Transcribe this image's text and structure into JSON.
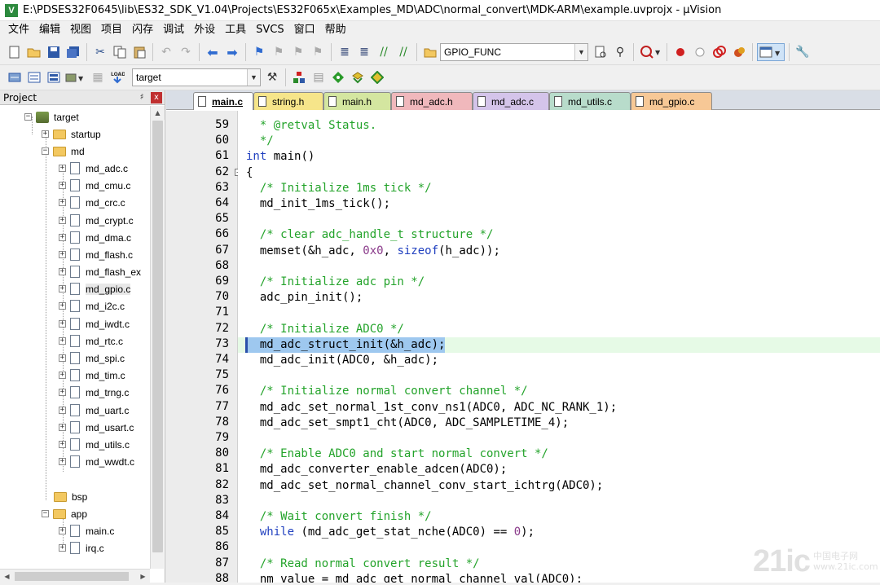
{
  "window": {
    "title": "E:\\PDSES32F0645\\lib\\ES32_SDK_V1.04\\Projects\\ES32F065x\\Examples_MD\\ADC\\normal_convert\\MDK-ARM\\example.uvprojx - µVision",
    "app_icon_letter": "V"
  },
  "menu": [
    "文件",
    "编辑",
    "视图",
    "项目",
    "闪存",
    "调试",
    "外设",
    "工具",
    "SVCS",
    "窗口",
    "帮助"
  ],
  "toolbar1": {
    "find_combo_value": "GPIO_FUNC"
  },
  "toolbar2": {
    "target_combo_value": "target"
  },
  "project_panel": {
    "title": "Project",
    "pin": "♯",
    "close": "x",
    "tree": {
      "target": "target",
      "startup": "startup",
      "md": "md",
      "md_files": [
        "md_adc.c",
        "md_cmu.c",
        "md_crc.c",
        "md_crypt.c",
        "md_dma.c",
        "md_flash.c",
        "md_flash_ex",
        "md_gpio.c",
        "md_i2c.c",
        "md_iwdt.c",
        "md_rtc.c",
        "md_spi.c",
        "md_tim.c",
        "md_trng.c",
        "md_uart.c",
        "md_usart.c",
        "md_utils.c",
        "md_wwdt.c"
      ],
      "bsp": "bsp",
      "app": "app",
      "app_files": [
        "main.c",
        "irq.c"
      ]
    }
  },
  "tabs": [
    {
      "label": "main.c",
      "color": "#ffffff",
      "active": true
    },
    {
      "label": "string.h",
      "color": "#f6e58a",
      "active": false
    },
    {
      "label": "main.h",
      "color": "#d4e6a0",
      "active": false
    },
    {
      "label": "md_adc.h",
      "color": "#f0b8bc",
      "active": false
    },
    {
      "label": "md_adc.c",
      "color": "#d4c4ea",
      "active": false
    },
    {
      "label": "md_utils.c",
      "color": "#b8dccb",
      "active": false
    },
    {
      "label": "md_gpio.c",
      "color": "#f7c896",
      "active": false
    }
  ],
  "editor": {
    "current_line": 73,
    "lines": [
      {
        "no": "59",
        "text": "  * @retval Status.",
        "kind": "comment"
      },
      {
        "no": "60",
        "text": "  */",
        "kind": "comment"
      },
      {
        "no": "61",
        "text": "int main()",
        "kind": "code"
      },
      {
        "no": "62",
        "text": "{",
        "kind": "code"
      },
      {
        "no": "63",
        "text": "  /* Initialize 1ms tick */",
        "kind": "comment"
      },
      {
        "no": "64",
        "text": "  md_init_1ms_tick();",
        "kind": "code"
      },
      {
        "no": "65",
        "text": "",
        "kind": "code"
      },
      {
        "no": "66",
        "text": "  /* clear adc_handle_t structure */",
        "kind": "comment"
      },
      {
        "no": "67",
        "text": "  memset(&h_adc, 0x0, sizeof(h_adc));",
        "kind": "code"
      },
      {
        "no": "68",
        "text": "",
        "kind": "code"
      },
      {
        "no": "69",
        "text": "  /* Initialize adc pin */",
        "kind": "comment"
      },
      {
        "no": "70",
        "text": "  adc_pin_init();",
        "kind": "code"
      },
      {
        "no": "71",
        "text": "",
        "kind": "code"
      },
      {
        "no": "72",
        "text": "  /* Initialize ADC0 */",
        "kind": "comment"
      },
      {
        "no": "73",
        "text": "  md_adc_struct_init(&h_adc);",
        "kind": "code"
      },
      {
        "no": "74",
        "text": "  md_adc_init(ADC0, &h_adc);",
        "kind": "code"
      },
      {
        "no": "75",
        "text": "",
        "kind": "code"
      },
      {
        "no": "76",
        "text": "  /* Initialize normal convert channel */",
        "kind": "comment"
      },
      {
        "no": "77",
        "text": "  md_adc_set_normal_1st_conv_ns1(ADC0, ADC_NC_RANK_1);",
        "kind": "code"
      },
      {
        "no": "78",
        "text": "  md_adc_set_smpt1_cht(ADC0, ADC_SAMPLETIME_4);",
        "kind": "code"
      },
      {
        "no": "79",
        "text": "",
        "kind": "code"
      },
      {
        "no": "80",
        "text": "  /* Enable ADC0 and start normal convert */",
        "kind": "comment"
      },
      {
        "no": "81",
        "text": "  md_adc_converter_enable_adcen(ADC0);",
        "kind": "code"
      },
      {
        "no": "82",
        "text": "  md_adc_set_normal_channel_conv_start_ichtrg(ADC0);",
        "kind": "code"
      },
      {
        "no": "83",
        "text": "",
        "kind": "code"
      },
      {
        "no": "84",
        "text": "  /* Wait convert finish */",
        "kind": "comment"
      },
      {
        "no": "85",
        "text": "  while (md_adc_get_stat_nche(ADC0) == 0);",
        "kind": "code"
      },
      {
        "no": "86",
        "text": "",
        "kind": "code"
      },
      {
        "no": "87",
        "text": "  /* Read normal convert result */",
        "kind": "comment"
      },
      {
        "no": "88",
        "text": "  nm_value = md_adc_get_normal_channel_val(ADC0);",
        "kind": "code"
      }
    ]
  },
  "watermark": {
    "big": "21ic",
    "small_line1": "中国电子网",
    "small_line2": "www.21ic.com"
  },
  "colors": {
    "comment": "#23a32a",
    "keyword": "#1f3fbf",
    "number": "#8a3a8a",
    "selection": "#9ec8ef",
    "current_line": "#e6fae6"
  }
}
